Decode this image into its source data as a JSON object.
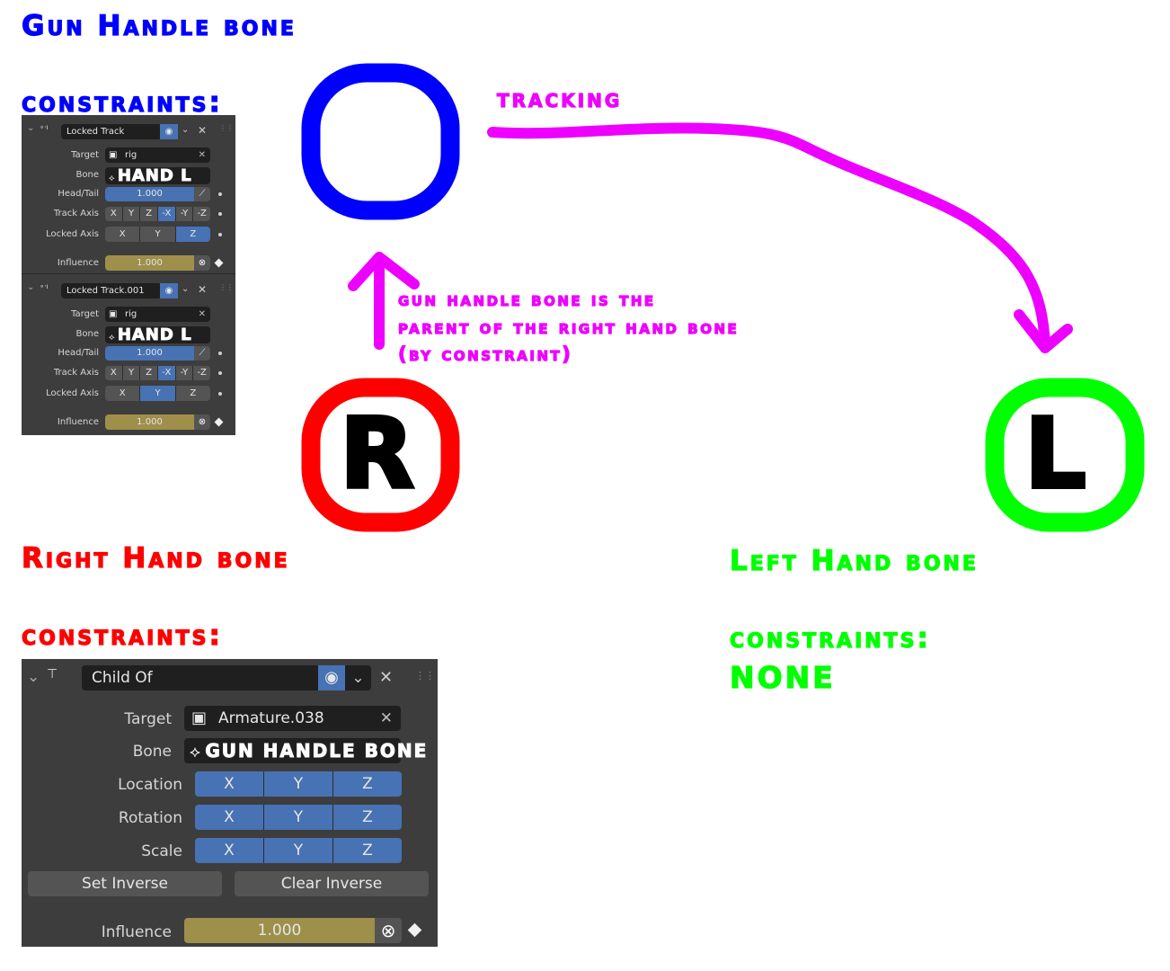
{
  "colors": {
    "gun_handle": "#0000ff",
    "right_hand": "#ff0000",
    "left_hand": "#00ff00",
    "annotation": "#ee00ff"
  },
  "gun_section": {
    "title": "Gun Handle bone",
    "constraints_label": "constraints:"
  },
  "right_section": {
    "title": "Right Hand bone",
    "constraints_label": "constraints:",
    "circle_letter": "R"
  },
  "left_section": {
    "title": "Left Hand bone",
    "constraints_label": "constraints:",
    "constraints_value": "NONE",
    "circle_letter": "L"
  },
  "annotations": {
    "tracking": "tracking",
    "parent_line1": "gun handle bone is the",
    "parent_line2": "parent of the right hand bone",
    "parent_line3": "(by constraint)"
  },
  "gun_constraints": [
    {
      "name": "Locked Track",
      "target_label": "Target",
      "target": "rig",
      "bone_label": "Bone",
      "bone": "HAND L",
      "headtail_label": "Head/Tail",
      "headtail": "1.000",
      "track_axis_label": "Track Axis",
      "track_axis": [
        "X",
        "Y",
        "Z",
        "-X",
        "-Y",
        "-Z"
      ],
      "track_axis_selected": "-X",
      "locked_axis_label": "Locked Axis",
      "locked_axis": [
        "X",
        "Y",
        "Z"
      ],
      "locked_axis_selected": "Z",
      "influence_label": "Influence",
      "influence": "1.000"
    },
    {
      "name": "Locked Track.001",
      "target_label": "Target",
      "target": "rig",
      "bone_label": "Bone",
      "bone": "HAND L",
      "headtail_label": "Head/Tail",
      "headtail": "1.000",
      "track_axis_label": "Track Axis",
      "track_axis": [
        "X",
        "Y",
        "Z",
        "-X",
        "-Y",
        "-Z"
      ],
      "track_axis_selected": "-X",
      "locked_axis_label": "Locked Axis",
      "locked_axis": [
        "X",
        "Y",
        "Z"
      ],
      "locked_axis_selected": "Y",
      "influence_label": "Influence",
      "influence": "1.000"
    }
  ],
  "child_of": {
    "name": "Child Of",
    "target_label": "Target",
    "target": "Armature.038",
    "bone_label": "Bone",
    "bone": "GUN HANDLE BONE",
    "location_label": "Location",
    "location": [
      "X",
      "Y",
      "Z"
    ],
    "rotation_label": "Rotation",
    "rotation": [
      "X",
      "Y",
      "Z"
    ],
    "scale_label": "Scale",
    "scale": [
      "X",
      "Y",
      "Z"
    ],
    "set_inverse": "Set Inverse",
    "clear_inverse": "Clear Inverse",
    "influence_label": "Influence",
    "influence": "1.000"
  }
}
